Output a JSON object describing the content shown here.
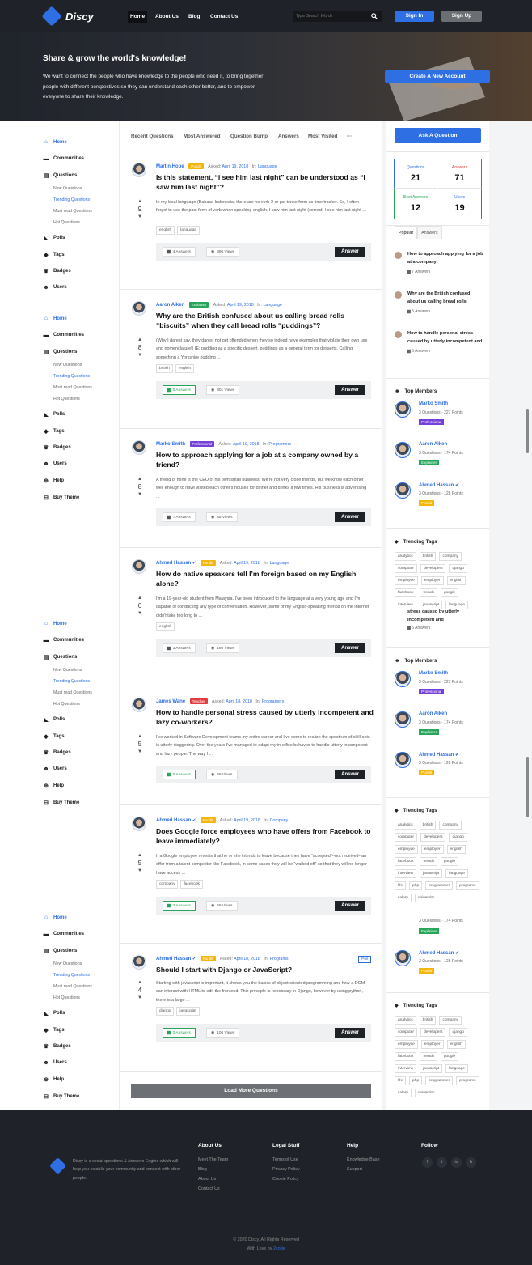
{
  "brand": {
    "name": "Discy"
  },
  "nav": {
    "items": [
      {
        "label": "Home",
        "active": true
      },
      {
        "label": "About Us"
      },
      {
        "label": "Blog"
      },
      {
        "label": "Contact Us"
      }
    ],
    "search_placeholder": "Type Search Words",
    "signin": "Sign In",
    "signup": "Sign Up"
  },
  "hero": {
    "title": "Share & grow the world's knowledge!",
    "text": "We want to connect the people who have knowledge to the people who need it, to bring together people with different perspectives so they can understand each other better, and to empower everyone to share their knowledge.",
    "cta": "Create A New Account"
  },
  "sidebar": {
    "blocks": [
      {
        "items": [
          {
            "label": "Home",
            "icon": "home-icon",
            "active": true
          },
          {
            "label": "Communities",
            "icon": "folder-icon"
          },
          {
            "label": "Questions",
            "icon": "book-icon",
            "subs": [
              "New Questions",
              "Trending Questions",
              "Must read Questions",
              "Hot Questions"
            ]
          },
          {
            "label": "Polls",
            "icon": "poll-icon"
          },
          {
            "label": "Tags",
            "icon": "tag-icon"
          },
          {
            "label": "Badges",
            "icon": "trophy-icon"
          },
          {
            "label": "Users",
            "icon": "users-icon"
          }
        ]
      },
      {
        "items": [
          {
            "label": "Home",
            "icon": "home-icon",
            "active": true
          },
          {
            "label": "Communities",
            "icon": "folder-icon"
          },
          {
            "label": "Questions",
            "icon": "book-icon",
            "subs": [
              "New Questions",
              "Trending Questions",
              "Must read Questions",
              "Hot Questions"
            ]
          },
          {
            "label": "Polls",
            "icon": "poll-icon"
          },
          {
            "label": "Tags",
            "icon": "tag-icon"
          },
          {
            "label": "Badges",
            "icon": "trophy-icon"
          },
          {
            "label": "Users",
            "icon": "users-icon"
          },
          {
            "label": "Help",
            "icon": "help-icon"
          },
          {
            "label": "Buy Theme",
            "icon": "cart-icon"
          }
        ]
      },
      {
        "items": [
          {
            "label": "Home",
            "icon": "home-icon",
            "active": true
          },
          {
            "label": "Communities",
            "icon": "folder-icon"
          },
          {
            "label": "Questions",
            "icon": "book-icon",
            "subs": [
              "New Questions",
              "Trending Questions",
              "Must read Questions",
              "Hot Questions"
            ]
          },
          {
            "label": "Polls",
            "icon": "poll-icon"
          },
          {
            "label": "Tags",
            "icon": "tag-icon"
          },
          {
            "label": "Badges",
            "icon": "trophy-icon"
          },
          {
            "label": "Users",
            "icon": "users-icon"
          },
          {
            "label": "Help",
            "icon": "help-icon"
          },
          {
            "label": "Buy Theme",
            "icon": "cart-icon"
          }
        ]
      },
      {
        "items": [
          {
            "label": "Home",
            "icon": "home-icon",
            "active": true
          },
          {
            "label": "Communities",
            "icon": "folder-icon"
          },
          {
            "label": "Questions",
            "icon": "book-icon",
            "subs": [
              "New Questions",
              "Trending Questions",
              "Must read Questions",
              "Hot Questions"
            ]
          },
          {
            "label": "Polls",
            "icon": "poll-icon"
          },
          {
            "label": "Tags",
            "icon": "tag-icon"
          },
          {
            "label": "Badges",
            "icon": "trophy-icon"
          },
          {
            "label": "Users",
            "icon": "users-icon"
          },
          {
            "label": "Help",
            "icon": "help-icon"
          },
          {
            "label": "Buy Theme",
            "icon": "cart-icon"
          }
        ]
      }
    ]
  },
  "tabs": [
    "Recent Questions",
    "Most Answered",
    "Question Bump",
    "Answers",
    "Most Visited",
    "···"
  ],
  "questions": [
    {
      "author": "Martin Hope",
      "badge": "Pundit",
      "badge_class": "pundit",
      "verified": false,
      "asked_label": "Asked:",
      "date": "April 19, 2018",
      "in_label": "In:",
      "category": "Language",
      "title": "Is this statement, “i see him last night” can be understood as “I saw him last night”?",
      "excerpt": "In my local language (Bahasa Indonesia) there are no verb-2 or pst tense form as time tracker. So, I often forgot to use the past form of verb when speaking english. I saw him last night (correct) I see him last night ...",
      "votes": "9",
      "tags": [
        "english",
        "language"
      ],
      "answers": "4 Answers",
      "answers_green": false,
      "views": "396 Views",
      "answer_btn": "Answer",
      "poll": ""
    },
    {
      "author": "Aaron Aiken",
      "badge": "Explainer",
      "badge_class": "explainer",
      "verified": false,
      "asked_label": "Asked:",
      "date": "April 19, 2018",
      "in_label": "In:",
      "category": "Language",
      "title": "Why are the British confused about us calling bread rolls “biscuits” when they call bread rolls “puddings”?",
      "excerpt": "(Why I darest say, they darest not get offended when they so indeed have examples that violate their own use and nomenclature!) IE: pudding as a specific dessert, puddings as a general term for desserts. Calling something a Yorkshire pudding ...",
      "votes": "8",
      "tags": [
        "british",
        "english"
      ],
      "answers": "5 Answers",
      "answers_green": true,
      "views": "401 Views",
      "answer_btn": "Answer",
      "poll": ""
    },
    {
      "author": "Marko Smith",
      "badge": "Professional",
      "badge_class": "professional",
      "verified": false,
      "asked_label": "Asked:",
      "date": "April 19, 2018",
      "in_label": "In:",
      "category": "Programers",
      "title": "How to approach applying for a job at a company owned by a friend?",
      "excerpt": "A friend of mine is the CEO of his own small business. We're not very close friends, but we know each other well enough to have visited each other's houses for dinner and drinks a few times. His business is advertising ...",
      "votes": "8",
      "tags": [],
      "answers": "7 Answers",
      "answers_green": false,
      "views": "85 Views",
      "answer_btn": "Answer",
      "poll": ""
    },
    {
      "author": "Ahmed Hassan",
      "badge": "Pundit",
      "badge_class": "pundit",
      "verified": true,
      "asked_label": "Asked:",
      "date": "April 19, 2018",
      "in_label": "In:",
      "category": "Language",
      "title": "How do native speakers tell I’m foreign based on my English alone?",
      "excerpt": "I'm a 19-year-old student from Malaysia. I've been introduced to the language at a very young age and I'm capable of conducting any type of conversation. However, some of my English-speaking friends on the internet didn't take too long to ...",
      "votes": "6",
      "tags": [
        "english"
      ],
      "answers": "3 Answers",
      "answers_green": false,
      "views": "180 Views",
      "answer_btn": "Answer",
      "poll": ""
    },
    {
      "author": "James Wane",
      "badge": "Teacher",
      "badge_class": "teacher",
      "verified": false,
      "asked_label": "Asked:",
      "date": "April 18, 2018",
      "in_label": "In:",
      "category": "Programers",
      "title": "How to handle personal stress caused by utterly incompetent and lazy co-workers?",
      "excerpt": "I've worked in Software Development teams my entire career and I've come to realize the spectrum of skill-sets is utterly staggering. Over the years I've managed to adapt my in-office behavior to handle utterly incompetent and lazy people. The way I ...",
      "votes": "5",
      "tags": [],
      "answers": "5 Answers",
      "answers_green": true,
      "views": "46 Views",
      "answer_btn": "Answer",
      "poll": ""
    },
    {
      "author": "Ahmed Hassan",
      "badge": "Pundit",
      "badge_class": "pundit",
      "verified": true,
      "asked_label": "Asked:",
      "date": "April 19, 2018",
      "in_label": "In:",
      "category": "Company",
      "title": "Does Google force employees who have offers from Facebook to leave immediately?",
      "excerpt": "If a Google employee reveals that he or she intends to leave because they have “accepted”--not received--an offer from a talent competitor like Facebook, in some cases they will be “walked off” so that they will no longer have access ...",
      "votes": "5",
      "tags": [
        "company",
        "facebook"
      ],
      "answers": "3 Answers",
      "answers_green": true,
      "views": "66 Views",
      "answer_btn": "Answer",
      "poll": ""
    },
    {
      "author": "Ahmed Hassan",
      "badge": "Pundit",
      "badge_class": "pundit",
      "verified": true,
      "asked_label": "Asked:",
      "date": "April 18, 2018",
      "in_label": "In:",
      "category": "Programs",
      "title": "Should I start with Django or JavaScript?",
      "excerpt": "Starting with javascript is important, it shows you the basics of object oriented programming and how a DOM can interact with HTML to edit the frontend. This principle is necessary in Django, however by using python, there is a large ...",
      "votes": "4",
      "tags": [
        "django",
        "javascript"
      ],
      "answers": "2 Answers",
      "answers_green": true,
      "views": "106 Views",
      "answer_btn": "Answer",
      "poll": "Poll"
    }
  ],
  "load_more": "Load More Questions",
  "right": {
    "ask_btn": "Ask A Question",
    "stats": [
      {
        "label": "Questions",
        "value": "21",
        "color": "#2f6fe4"
      },
      {
        "label": "Answers",
        "value": "71",
        "color": "#e23b3b"
      },
      {
        "label": "Best Answers",
        "value": "12",
        "color": "#27a65a"
      },
      {
        "label": "Users",
        "value": "19",
        "color": "#2f6fe4"
      }
    ],
    "tabs": [
      "Popular",
      "Answers"
    ],
    "popular": [
      {
        "title": "How to approach applying for a job at a company",
        "count": "7 Answers"
      },
      {
        "title": "Why are the British confused about us calling bread rolls",
        "count": "5 Answers"
      },
      {
        "title": "How to handle personal stress caused by utterly incompetent and",
        "count": "5 Answers"
      }
    ],
    "top_members_title": "Top Members",
    "members": [
      {
        "name": "Marko Smith",
        "stats": "3 Questions · 227 Points",
        "badge": "Professional",
        "badge_color": "#7440d8",
        "verified": false
      },
      {
        "name": "Aaron Aiken",
        "stats": "3 Questions · 174 Points",
        "badge": "Explainer",
        "badge_color": "#27a65a",
        "verified": false
      },
      {
        "name": "Ahmed Hassan",
        "stats": "3 Questions · 128 Points",
        "badge": "Pundit",
        "badge_color": "#f2b60f",
        "verified": true
      }
    ],
    "trending_title": "Trending Tags",
    "tags_a": [
      "analytics",
      "british",
      "company",
      "computer",
      "developers",
      "django",
      "employee",
      "employer",
      "english",
      "facebook",
      "french",
      "google",
      "interview",
      "javascript",
      "language"
    ],
    "tags_b": [
      "analytics",
      "british",
      "company",
      "computer",
      "developers",
      "django",
      "employee",
      "employer",
      "english",
      "facebook",
      "french",
      "google",
      "interview",
      "javascript",
      "language",
      "life",
      "php",
      "programmer",
      "programs",
      "salary",
      "university"
    ],
    "dup_pop": {
      "title": "stress caused by utterly incompetent and",
      "count": "5 Answers"
    },
    "dup_member": {
      "stats": "3 Questions · 174 Points",
      "badge": "Explainer",
      "badge_color": "#27a65a"
    }
  },
  "footer": {
    "about": "Discy is a social questions & Answers Engine which will help you establis your community and connect with other people.",
    "cols": [
      {
        "title": "About Us",
        "links": [
          "Meet The Team",
          "Blog",
          "About Us",
          "Contact Us"
        ]
      },
      {
        "title": "Legal Stuff",
        "links": [
          "Terms of Use",
          "Privacy Policy",
          "Cookie Policy"
        ]
      },
      {
        "title": "Help",
        "links": [
          "Knowledge Base",
          "Support"
        ]
      },
      {
        "title": "Follow",
        "links": []
      }
    ],
    "social": [
      "f",
      "t",
      "in",
      "h"
    ],
    "copyright": "© 2020 Discy. All Rights Reserved",
    "credit_prefix": "With Love by",
    "credit_name": "2code"
  }
}
